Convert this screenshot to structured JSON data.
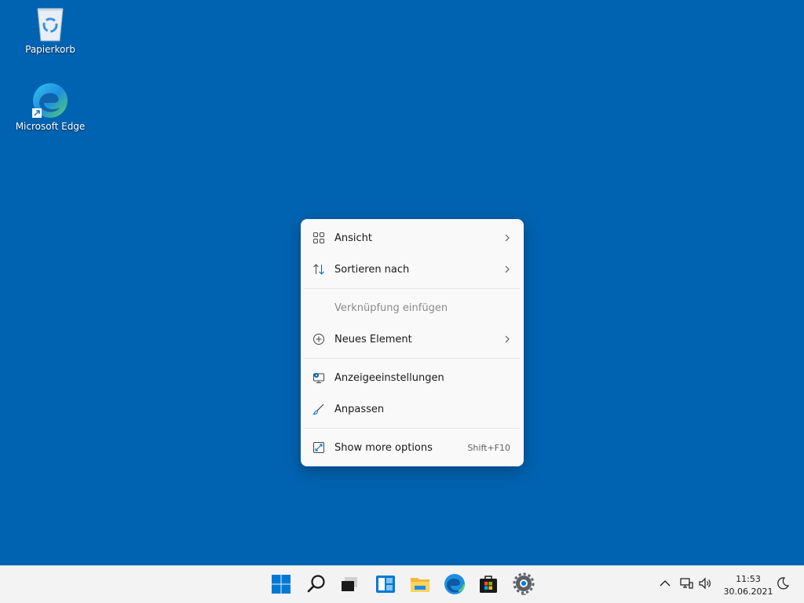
{
  "desktop": {
    "icons": [
      {
        "label": "Papierkorb",
        "icon": "recycle-bin-icon"
      },
      {
        "label": "Microsoft Edge",
        "icon": "edge-icon"
      }
    ]
  },
  "context_menu": {
    "items": [
      {
        "label": "Ansicht",
        "icon": "grid-view-icon",
        "submenu": true
      },
      {
        "label": "Sortieren nach",
        "icon": "sort-arrows-icon",
        "submenu": true
      },
      {
        "label": "Verknüpfung einfügen",
        "disabled": true
      },
      {
        "label": "Neues Element",
        "icon": "plus-circle-icon",
        "submenu": true
      },
      {
        "label": "Anzeigeeinstellungen",
        "icon": "display-settings-icon"
      },
      {
        "label": "Anpassen",
        "icon": "brush-icon"
      },
      {
        "label": "Show more options",
        "icon": "expand-icon",
        "shortcut": "Shift+F10"
      }
    ]
  },
  "taskbar": {
    "apps": [
      "start-icon",
      "search-icon",
      "task-view-icon",
      "widgets-icon",
      "file-explorer-icon",
      "edge-icon",
      "store-icon",
      "settings-icon"
    ],
    "tray": [
      "chevron-up-icon",
      "network-icon",
      "volume-icon",
      "notifications-moon-icon"
    ],
    "time": "11:53",
    "date": "30.06.2021"
  },
  "colors": {
    "desktop": "#0063b1",
    "accent": "#0067c0"
  }
}
